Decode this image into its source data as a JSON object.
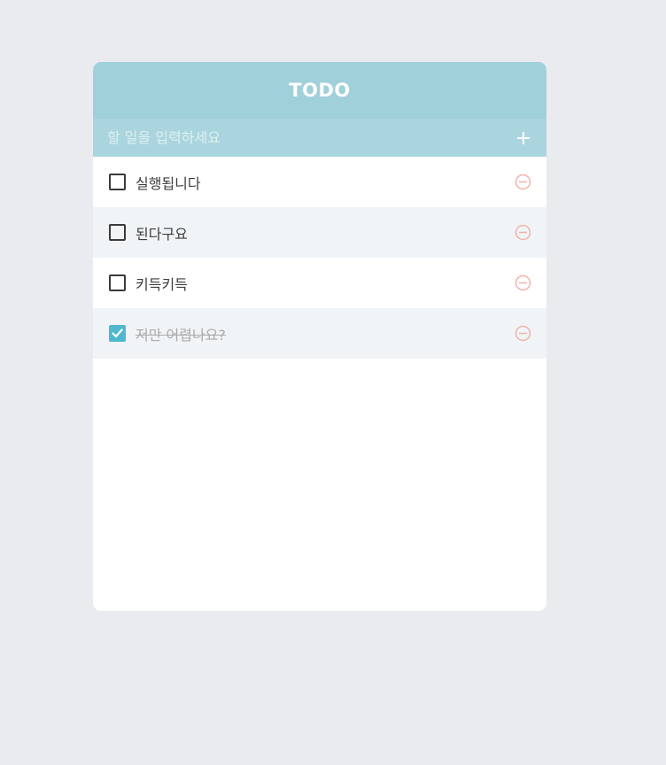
{
  "app": {
    "title": "TODO"
  },
  "input": {
    "placeholder": "할 일을 입력하세요",
    "value": ""
  },
  "todos": [
    {
      "text": "실행됩니다",
      "checked": false
    },
    {
      "text": "된다구요",
      "checked": false
    },
    {
      "text": "키득키득",
      "checked": false
    },
    {
      "text": "저만 어렵나요?",
      "checked": true
    }
  ],
  "icons": {
    "add": "plus-icon",
    "remove": "minus-circle-icon",
    "check": "check-icon"
  },
  "colors": {
    "header": "#a0d0da",
    "input_bar": "#aad5de",
    "checked": "#4fb8cf",
    "remove": "#f0b2a8",
    "background": "#e9ebef"
  }
}
